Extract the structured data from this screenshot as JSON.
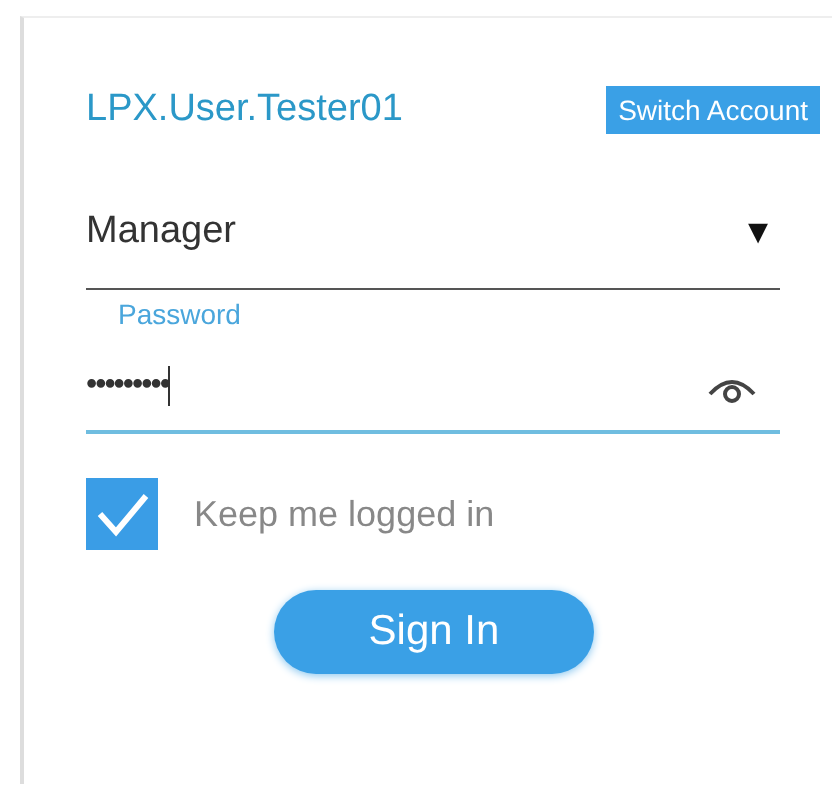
{
  "account": {
    "username": "LPX.User.Tester01",
    "switch_button": "Switch Account"
  },
  "role_select": {
    "value": "Manager",
    "caret": "▾"
  },
  "password": {
    "label": "Password",
    "value": "•••••••••",
    "focused": true
  },
  "keep_logged_in": {
    "label": "Keep me logged in",
    "checked": true
  },
  "sign_in_button": "Sign In"
}
